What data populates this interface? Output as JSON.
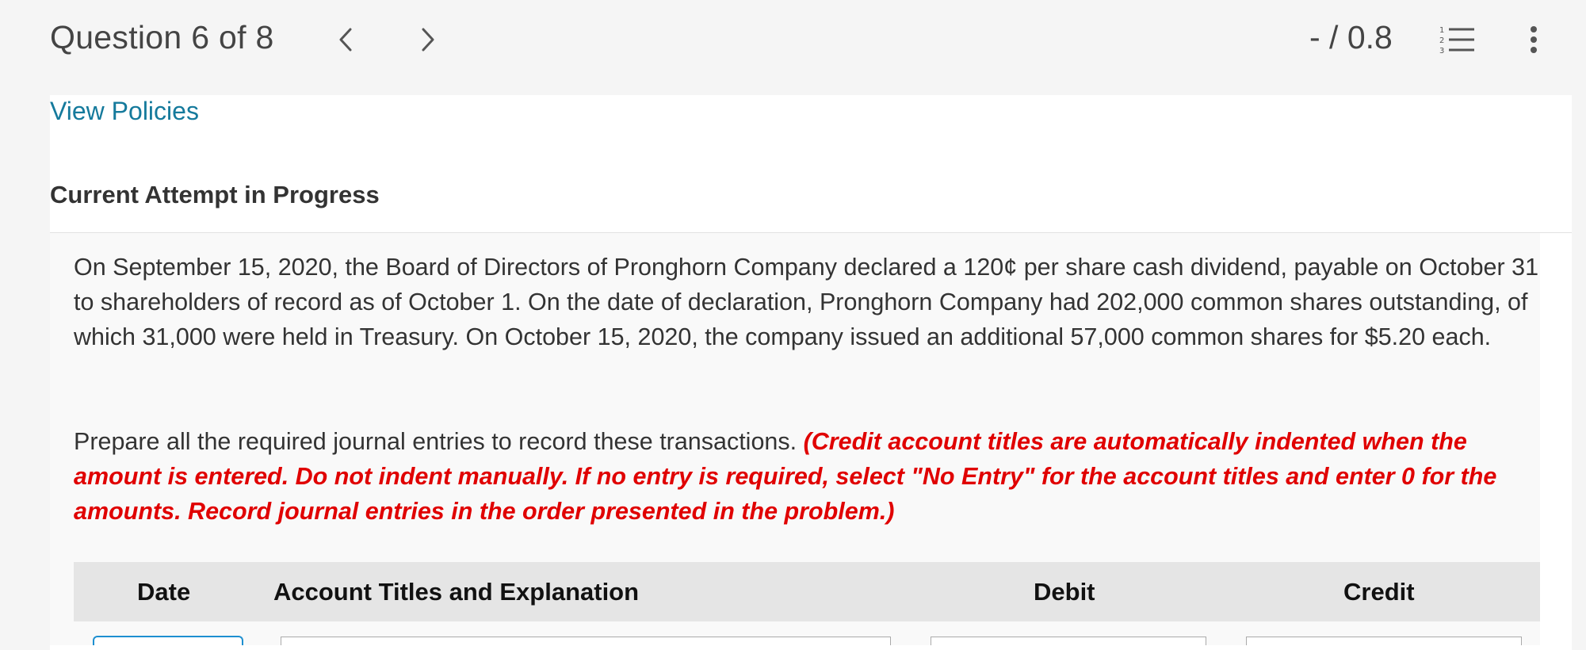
{
  "header": {
    "question_title": "Question 6 of 8",
    "score": "- / 0.8",
    "prev_icon": "chevron-left-icon",
    "next_icon": "chevron-right-icon",
    "list_icon": "numbered-list-icon",
    "more_icon": "more-vertical-icon"
  },
  "links": {
    "view_policies": "View Policies"
  },
  "attempt": {
    "label": "Current Attempt in Progress"
  },
  "problem": {
    "text": "On September 15, 2020, the Board of Directors of Pronghorn Company declared a 120¢ per share cash dividend, payable on October 31 to shareholders of record as of October 1. On the date of declaration, Pronghorn Company had 202,000 common shares outstanding, of which 31,000 were held in Treasury. On October 15, 2020, the company issued an additional 57,000 common shares for $5.20 each.",
    "instruction": "Prepare all the required journal entries to record these transactions.",
    "instruction_note": "(Credit account titles are automatically indented when the amount is entered. Do not indent manually. If no entry is required, select \"No Entry\" for the account titles and enter 0 for the amounts. Record journal entries in the order presented in the problem.)"
  },
  "table": {
    "headers": {
      "date": "Date",
      "account": "Account Titles and Explanation",
      "debit": "Debit",
      "credit": "Credit"
    }
  },
  "colors": {
    "link": "#157a9c",
    "note_red": "#e00000",
    "active_input_border": "#1d8fd0",
    "table_header_bg": "#e5e5e5"
  }
}
